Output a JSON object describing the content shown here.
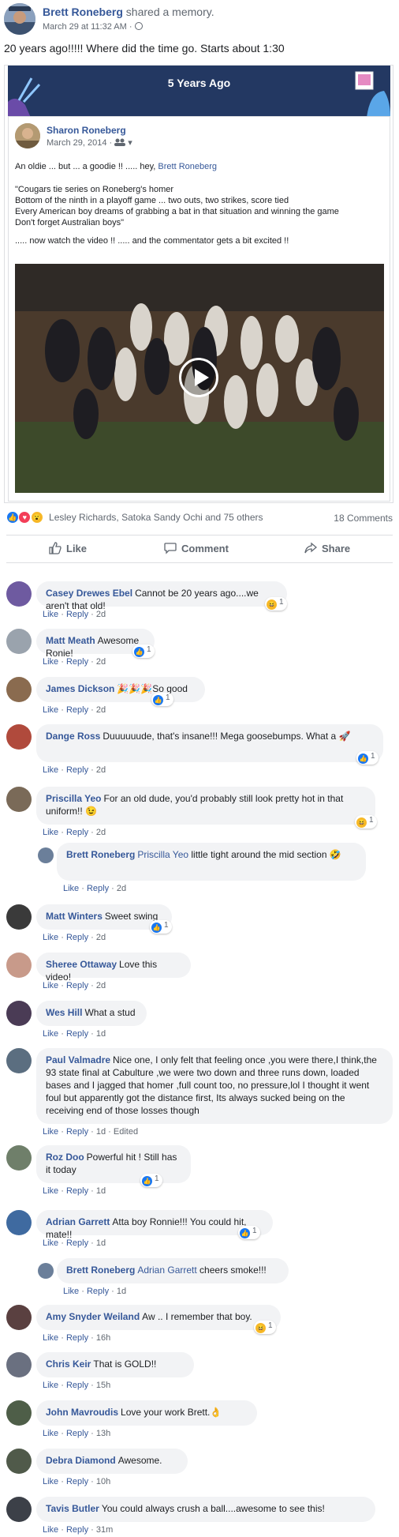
{
  "post": {
    "author": "Brett Roneberg",
    "action": "shared a memory.",
    "timestamp": "March 29 at 11:32 AM",
    "text": "20 years ago!!!!! Where did the time go. Starts about 1:30"
  },
  "memory": {
    "banner_title": "5 Years Ago",
    "shared_post": {
      "author": "Sharon Roneberg",
      "date": "March 29, 2014",
      "line1_prefix": "An oldie ... but ... a goodie !! ..... hey, ",
      "line1_mention": "Brett Roneberg",
      "quote_lines": [
        "\"Cougars tie series on Roneberg's homer",
        "Bottom of the ninth in a playoff game ... two outs, two strikes, score tied",
        "Every American boy dreams of grabbing a bat in that situation and winning the game",
        "Don't forget Australian boys\""
      ],
      "closing_line": "..... now watch the video !! ..... and the commentator gets a bit excited !!"
    }
  },
  "reactions": {
    "summary": "Lesley Richards, Satoka Sandy Ochi and 75 others",
    "comments_count": "18 Comments"
  },
  "actions": {
    "like": "Like",
    "comment": "Comment",
    "share": "Share"
  },
  "comment_labels": {
    "like": "Like",
    "reply": "Reply",
    "sep": "·"
  },
  "comments": [
    {
      "name": "Casey Drewes Ebel",
      "text": "Cannot be 20 years ago....we aren't that old!",
      "time": "2d",
      "react": "haha",
      "count": "1"
    },
    {
      "name": "Matt Meath",
      "text": "Awesome Ronie!",
      "time": "2d",
      "react": "like",
      "count": "1"
    },
    {
      "name": "James Dickson",
      "text": "🎉🎉🎉So good",
      "time": "2d",
      "react": "like",
      "count": "1"
    },
    {
      "name": "Dange Ross",
      "text": "Duuuuuude, that's insane!!! Mega goosebumps. What a 🚀",
      "time": "2d",
      "react": "like",
      "count": "1"
    },
    {
      "name": "Priscilla Yeo",
      "text": "For an old dude, you'd probably still look pretty hot in that uniform!! 😉",
      "time": "2d",
      "react": "haha",
      "count": "1"
    },
    {
      "name": "Matt Winters",
      "text": "Sweet swing",
      "time": "2d",
      "react": "like",
      "count": "1"
    },
    {
      "name": "Sheree Ottaway",
      "text": "Love this video!",
      "time": "2d"
    },
    {
      "name": "Wes Hill",
      "text": "What a stud",
      "time": "1d"
    },
    {
      "name": "Paul Valmadre",
      "text": "Nice one, I only felt that feeling once ,you were there,I think,the 93 state final at Cabulture ,we were two down and three runs down, loaded bases and I jagged that homer ,full count too, no pressure,lol I thought it went foul but apparently got the distance first, Its always sucked being on the receiving end of those losses though",
      "time": "1d",
      "edited": "Edited"
    },
    {
      "name": "Roz Doo",
      "text": "Powerful hit ! Still has it today",
      "time": "1d",
      "react": "like",
      "count": "1"
    },
    {
      "name": "Adrian Garrett",
      "text": "Atta boy Ronnie!!! You could hit, mate!!",
      "time": "1d",
      "react": "like",
      "count": "1"
    },
    {
      "name": "Amy Snyder Weiland",
      "text": "Aw .. I remember that boy.",
      "time": "16h",
      "react": "haha",
      "count": "1"
    },
    {
      "name": "Chris Keir",
      "text": "That is GOLD!!",
      "time": "15h"
    },
    {
      "name": "John Mavroudis",
      "text": "Love your work Brett.👌",
      "time": "13h"
    },
    {
      "name": "Debra Diamond",
      "text": "Awesome.",
      "time": "10h"
    },
    {
      "name": "Tavis Butler",
      "text": "You could always crush a ball....awesome to see this!",
      "time": "31m"
    }
  ],
  "replies": [
    {
      "name": "Brett Roneberg",
      "mention": "Priscilla Yeo",
      "text": "little tight around the mid section 🤣",
      "time": "2d"
    },
    {
      "name": "Brett Roneberg",
      "mention": "Adrian Garrett",
      "text": "cheers smoke!!!",
      "time": "1d"
    }
  ]
}
